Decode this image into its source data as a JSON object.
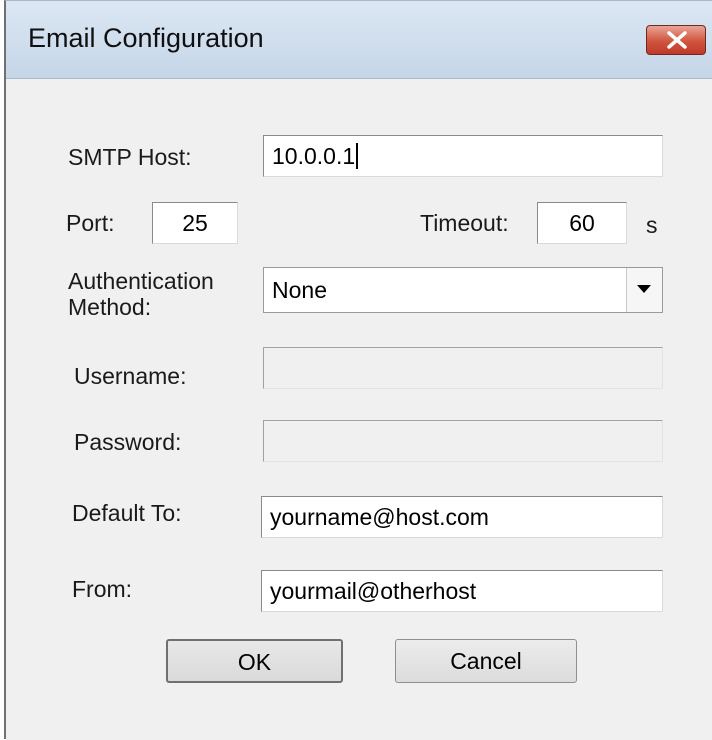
{
  "window": {
    "title": "Email Configuration"
  },
  "form": {
    "smtp_host_label": "SMTP Host:",
    "smtp_host_value": "10.0.0.1",
    "port_label": "Port:",
    "port_value": "25",
    "timeout_label": "Timeout:",
    "timeout_value": "60",
    "timeout_unit": "s",
    "auth_label_line1": "Authentication",
    "auth_label_line2": "Method:",
    "auth_selected": "None",
    "username_label": "Username:",
    "username_value": "",
    "password_label": "Password:",
    "password_value": "",
    "default_to_label": "Default To:",
    "default_to_value": "yourname@host.com",
    "from_label": "From:",
    "from_value": "yourmail@otherhost"
  },
  "buttons": {
    "ok_label": "OK",
    "cancel_label": "Cancel"
  },
  "icons": {
    "close": "close-icon",
    "dropdown": "chevron-down-icon"
  },
  "colors": {
    "close_button": "#c0392b",
    "dialog_background": "#f0f0f0"
  }
}
